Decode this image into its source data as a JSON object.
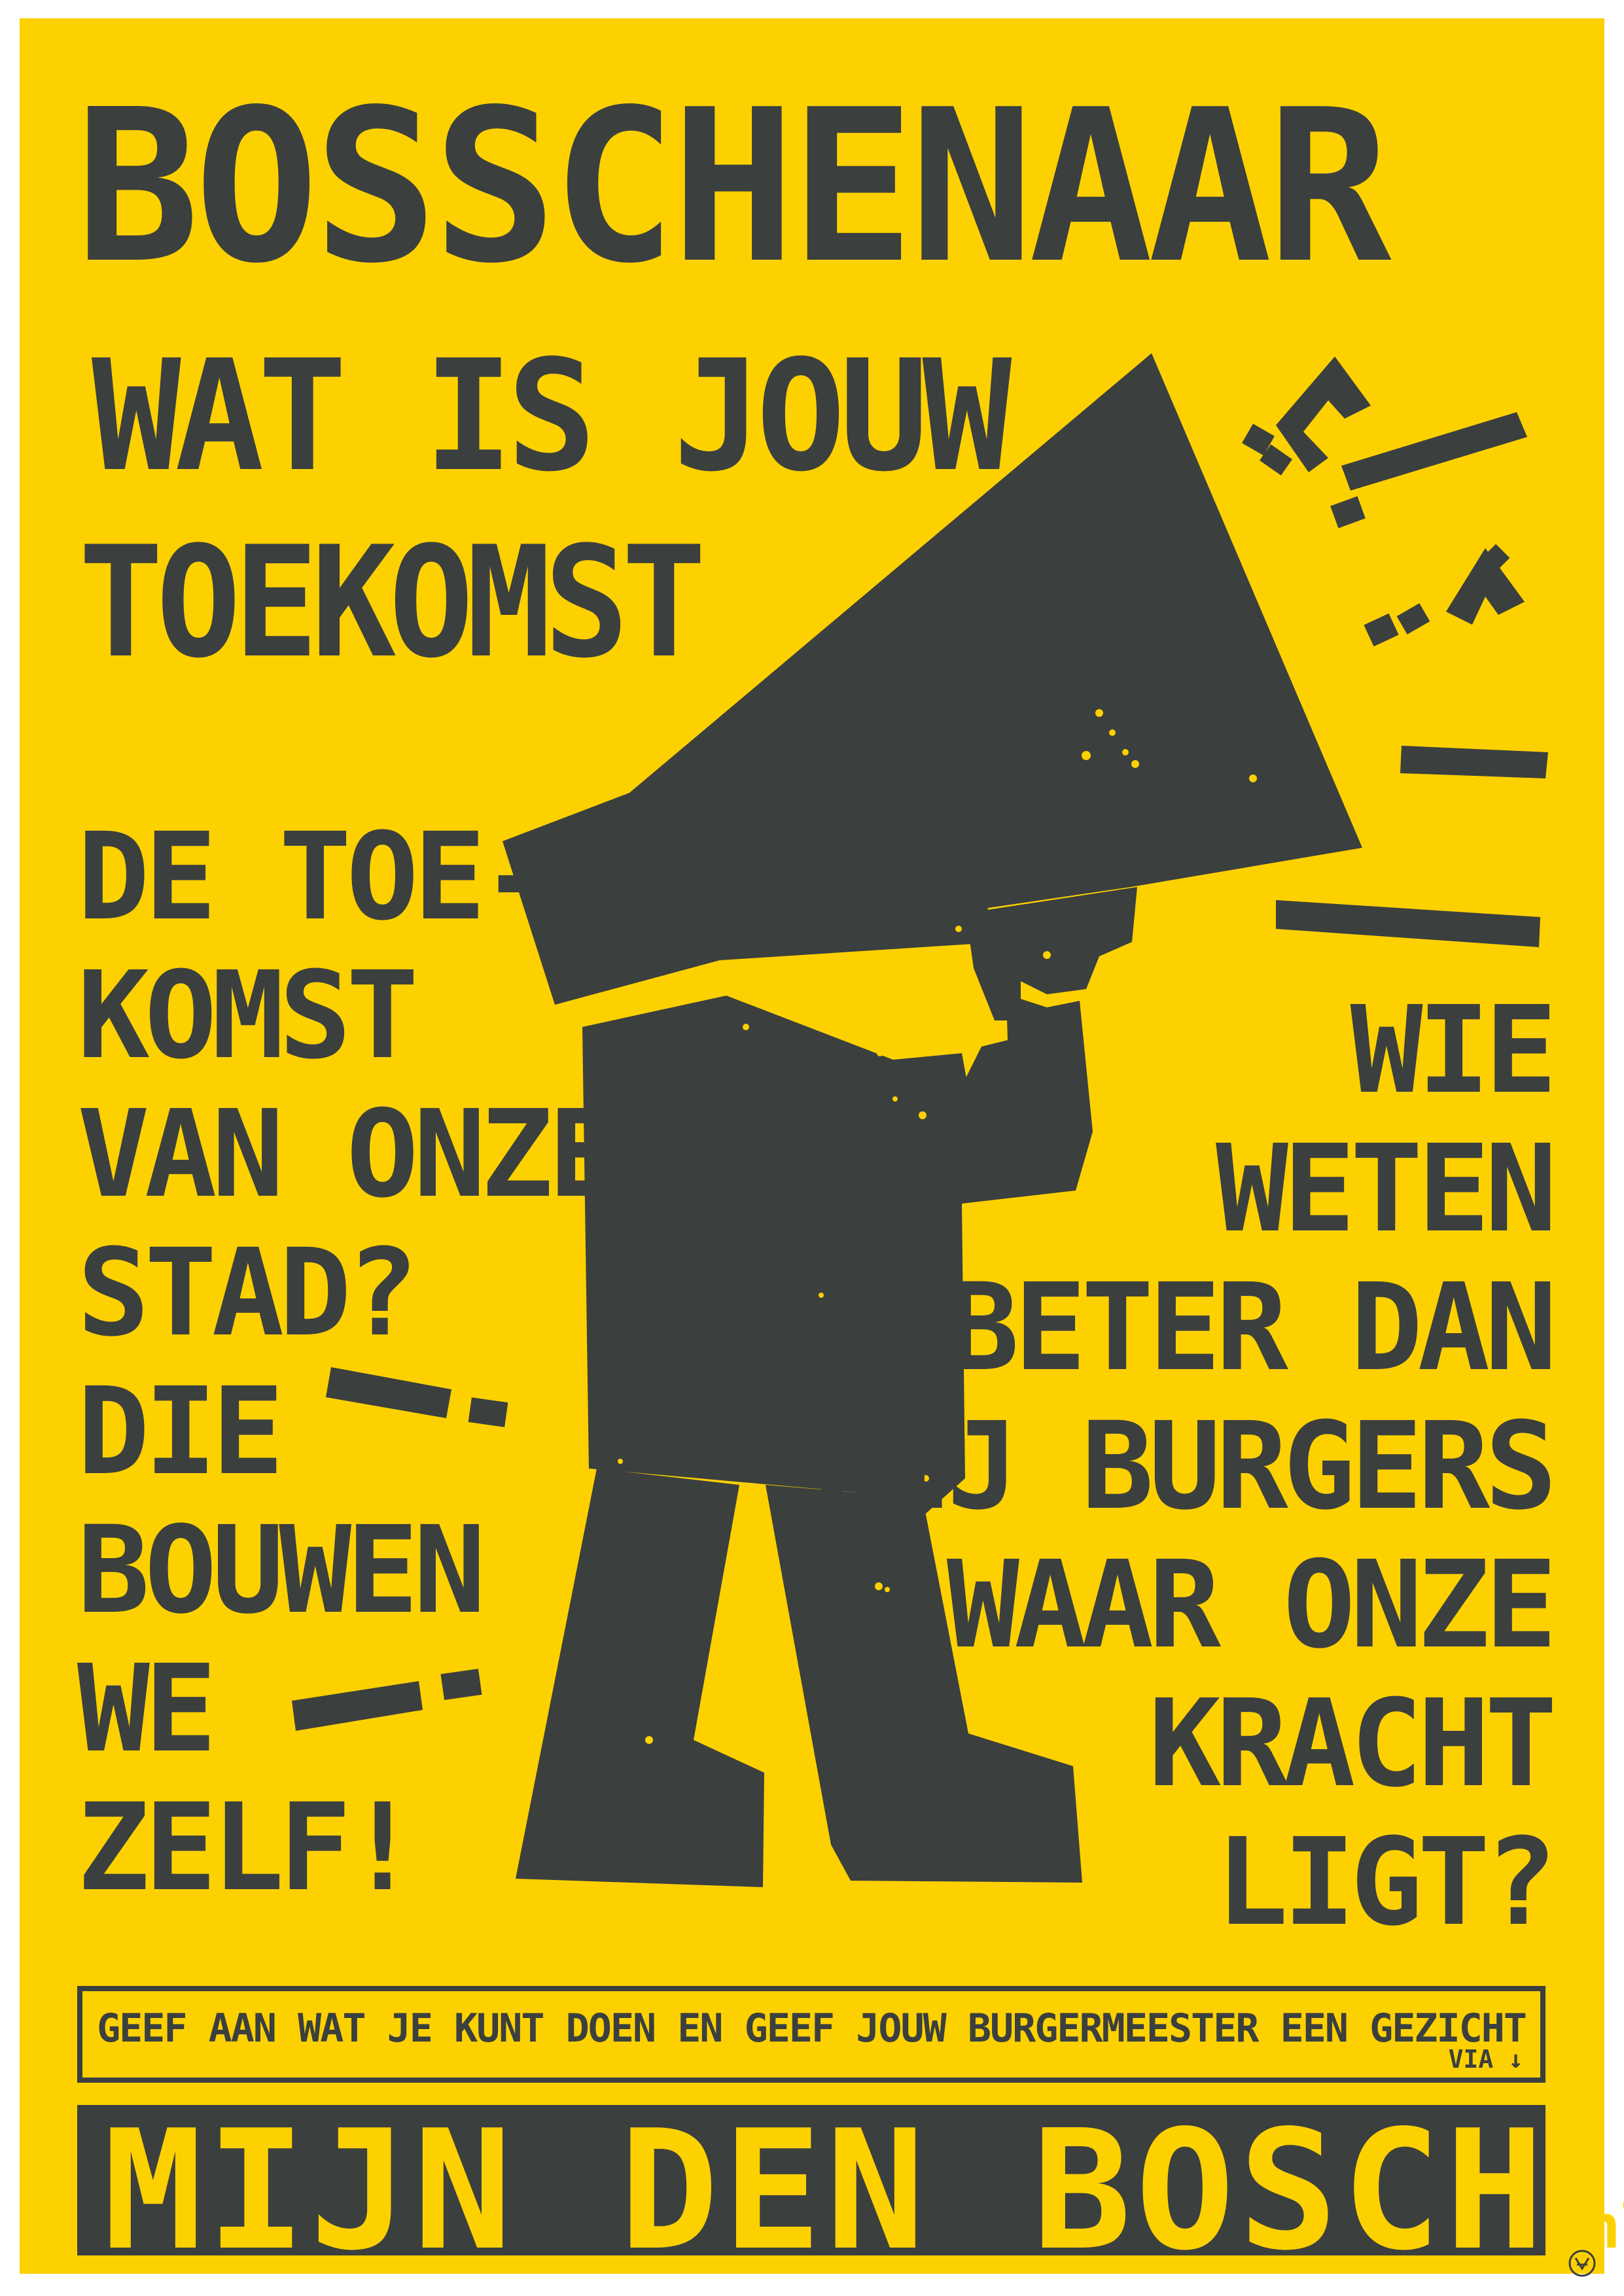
{
  "poster": {
    "title": "BOSSCHENAAR",
    "subtitle_line1": "WAT IS JOUW",
    "subtitle_line2": "TOEKOMST",
    "left_text": [
      "DE TOE-",
      "KOMST",
      "VAN ONZE",
      "STAD?",
      "DIE",
      "BOUWEN",
      "WE",
      "ZELF!"
    ],
    "right_text": [
      "WIE",
      "WETEN",
      "BETER DAN",
      "WIJ BURGERS",
      "WAAR ONZE",
      "KRACHT",
      "LIGT?"
    ],
    "call_to_action": "GEEF AAN WAT JE KUNT DOEN EN GEEF JOUW BURGERMEESTER EEN GEZICHT",
    "via_label": "VIA ↓",
    "website_name": "MIJN DEN BOSCH",
    "website_tld": ".nl"
  },
  "colors": {
    "background": "#fdd100",
    "ink": "#3b3f3e",
    "paper": "#ffffff"
  },
  "icons": {
    "figure": "megaphone-figure-illustration",
    "marks": [
      "exclamation-mark",
      "question-mark"
    ],
    "corner": "designer-logo-mark"
  }
}
